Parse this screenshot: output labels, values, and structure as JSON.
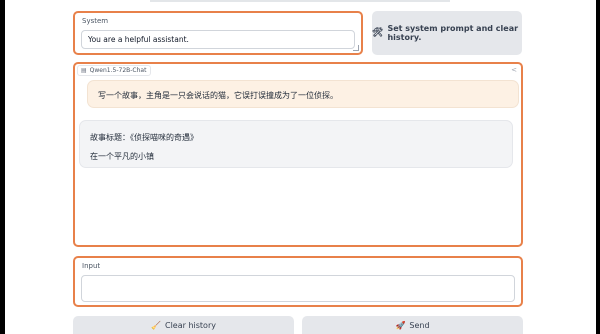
{
  "system": {
    "label": "System",
    "value": "You are a helpful assistant.",
    "button_label": "Set system prompt and clear history.",
    "button_icon": "hammer-wrench-icon"
  },
  "chat": {
    "model_label": "Qwen1.5-72B-Chat",
    "messages": [
      {
        "role": "user",
        "text": "写一个故事，主角是一只会说话的猫，它误打误撞成为了一位侦探。"
      },
      {
        "role": "assistant",
        "lines": [
          "故事标题：《侦探喵咪的奇遇》",
          "在一个平凡的小镇"
        ]
      }
    ]
  },
  "input": {
    "label": "Input",
    "value": ""
  },
  "buttons": {
    "clear_label": "Clear history",
    "clear_icon": "broom-icon",
    "send_label": "Send",
    "send_icon": "rocket-icon"
  },
  "colors": {
    "accent": "#e8814a",
    "user_bubble": "#fdf1e4",
    "bot_bubble": "#f3f4f6",
    "button_bg": "#e5e7eb"
  }
}
